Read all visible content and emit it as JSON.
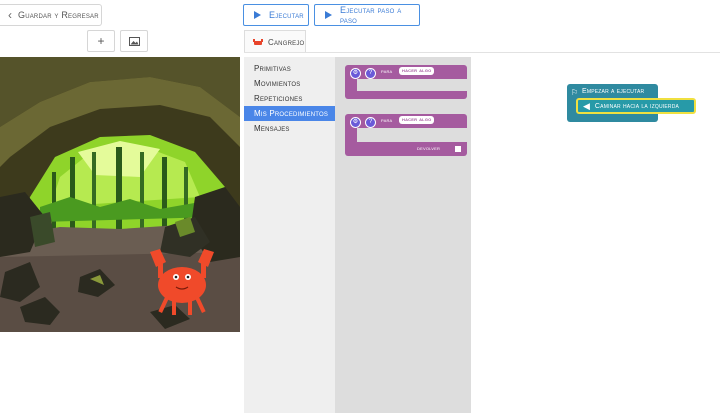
{
  "header": {
    "back_label": "Guardar y Regresar",
    "run_label": "Ejecutar",
    "step_label": "Ejecutar paso a paso",
    "add_symbol": "+",
    "tab_label": "Cangrejo"
  },
  "toolbox": {
    "items": [
      {
        "label": "Primitivas"
      },
      {
        "label": "Movimientos"
      },
      {
        "label": "Repeticiones"
      },
      {
        "label": "Mis Procedimientos"
      },
      {
        "label": "Mensajes"
      }
    ],
    "selected_index": 3
  },
  "flyout": {
    "block1": {
      "label": "para",
      "name": "hacer algo"
    },
    "block2": {
      "label": "para",
      "name": "hacer algo",
      "return_label": "devolver"
    }
  },
  "workspace": {
    "start_label": "Empezar a ejecutar",
    "move_label": "Caminar hacia la izquierda"
  },
  "colors": {
    "accent": "#4a90e2",
    "procedure": "#a55b9f",
    "start_block": "#2f8aa0",
    "selection": "#f0e040",
    "crab": "#f04a2a"
  }
}
